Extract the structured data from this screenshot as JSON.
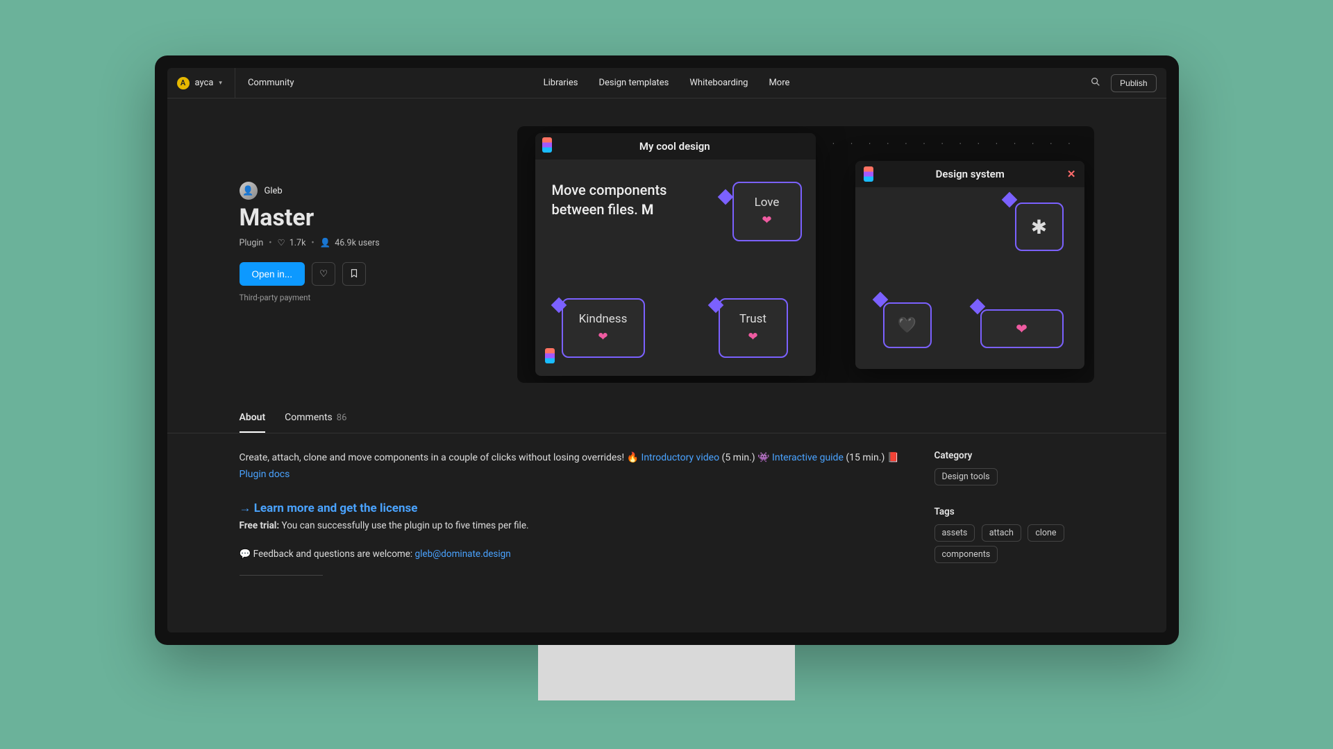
{
  "user": {
    "initial": "A",
    "name": "ayca"
  },
  "topnav": {
    "community": "Community",
    "items": [
      "Libraries",
      "Design templates",
      "Whiteboarding",
      "More"
    ],
    "publish": "Publish"
  },
  "hero": {
    "author": "Gleb",
    "title": "Master",
    "type": "Plugin",
    "likes": "1.7k",
    "users": "46.9k users",
    "open": "Open in...",
    "notice": "Third-party payment"
  },
  "banner": {
    "win1_title": "My cool design",
    "win2_title": "Design system",
    "desc": "Move components between files. ",
    "m_glyph": "M",
    "node1": "Love",
    "node2": "Kindness",
    "node3": "Trust"
  },
  "tabs": {
    "about": "About",
    "comments": "Comments",
    "comments_count": "86"
  },
  "description": {
    "line1a": "Create, attach, clone and move components in a couple of clicks without losing overrides! 🔥 ",
    "link1": "Introductory video",
    "paren1": " (5 min.) 👾 ",
    "link2": "Interactive guide",
    "paren2": " (15 min.) 📕 ",
    "link3": "Plugin docs",
    "arrow_prefix": "→ ",
    "arrow_link": "Learn more and get the license",
    "trial_label": "Free trial:",
    "trial_text": " You can successfully use the plugin up to five times per file.",
    "feedback_label": "💬 Feedback and questions are welcome: ",
    "feedback_email": "gleb@dominate.design"
  },
  "sidebar": {
    "category_head": "Category",
    "category_value": "Design tools",
    "tags_head": "Tags",
    "tags": [
      "assets",
      "attach",
      "clone",
      "components"
    ]
  }
}
